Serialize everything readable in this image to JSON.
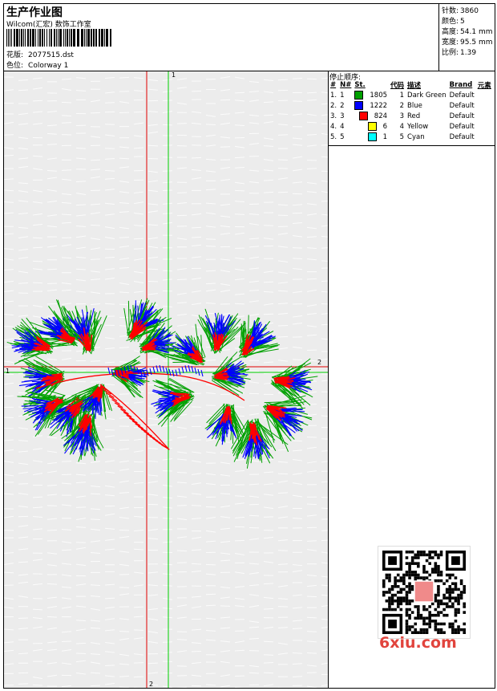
{
  "header": {
    "title": "生产作业图",
    "company": "Wilcom(汇宏) 数饰工作室",
    "design_label": "花版:",
    "design_value": "2077515.dst",
    "colorway_label": "色位:",
    "colorway_value": "Colorway 1"
  },
  "stats": [
    {
      "label": "针数:",
      "value": "3860"
    },
    {
      "label": "颜色:",
      "value": "5"
    },
    {
      "label": "高度:",
      "value": "54.1 mm"
    },
    {
      "label": "宽度:",
      "value": "95.5 mm"
    },
    {
      "label": "比例:",
      "value": "1.39"
    }
  ],
  "stop_sequence": {
    "title": "停止顺序:",
    "columns": [
      "#",
      "N#",
      "St.",
      "代码",
      "描述",
      "Brand",
      "元素"
    ],
    "rows": [
      {
        "idx": "1.",
        "n": "1",
        "color": "#00a000",
        "st": "1805",
        "code": "1",
        "desc": "Dark Green",
        "brand": "Default"
      },
      {
        "idx": "2.",
        "n": "2",
        "color": "#0000ff",
        "st": "1222",
        "code": "2",
        "desc": "Blue",
        "brand": "Default"
      },
      {
        "idx": "3.",
        "n": "3",
        "color": "#ff0000",
        "st": "824",
        "code": "3",
        "desc": "Red",
        "brand": "Default"
      },
      {
        "idx": "4.",
        "n": "4",
        "color": "#ffff00",
        "st": "6",
        "code": "4",
        "desc": "Yellow",
        "brand": "Default"
      },
      {
        "idx": "5.",
        "n": "5",
        "color": "#00ffff",
        "st": "1",
        "code": "5",
        "desc": "Cyan",
        "brand": "Default"
      }
    ]
  },
  "axes": {
    "green_top": "1",
    "green_left": "1",
    "red_right": "2",
    "red_bottom": "2"
  },
  "watermark": {
    "site": "6xiu.com"
  },
  "colors": {
    "green": "#00a000",
    "blue": "#0000ff",
    "red": "#ff0000",
    "axis_red": "#e00000",
    "axis_green": "#00d000"
  }
}
